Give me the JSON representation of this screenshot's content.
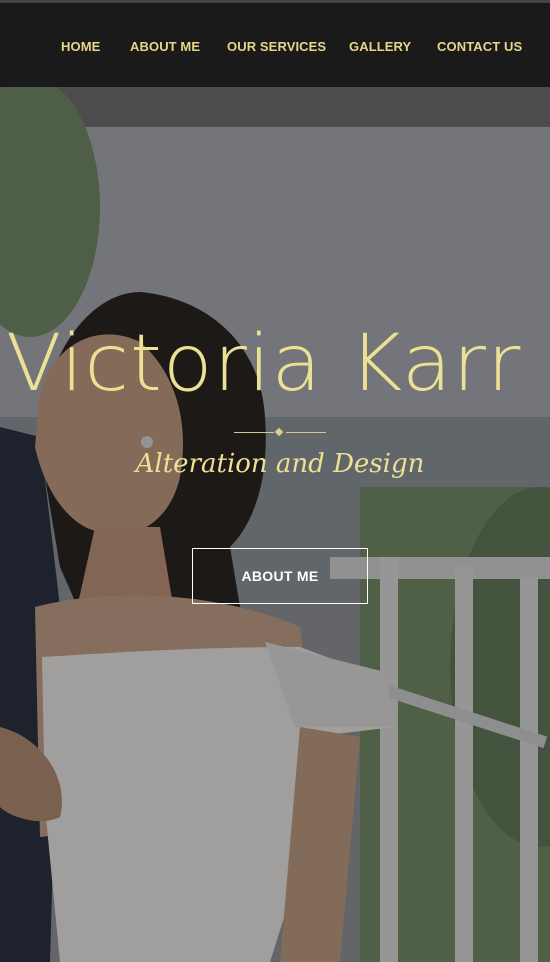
{
  "nav": {
    "items": [
      {
        "label": "HOME"
      },
      {
        "label": "ABOUT ME"
      },
      {
        "label": "OUR SERVICES"
      },
      {
        "label": "GALLERY"
      },
      {
        "label": "CONTACT US"
      }
    ]
  },
  "hero": {
    "title": "Victoria Karr",
    "subtitle": "Alteration and Design",
    "button_label": "ABOUT ME"
  },
  "colors": {
    "nav_background": "#1a1a1a",
    "nav_text": "#e8d48a",
    "title_gold": "#ece094",
    "button_border": "#ffffff"
  }
}
